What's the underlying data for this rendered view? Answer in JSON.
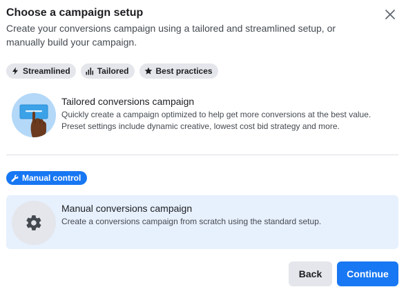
{
  "dialog": {
    "title": "Choose a campaign setup",
    "subtitle": "Create your conversions campaign using a tailored and streamlined setup, or manually build your campaign.",
    "close_icon": "close-icon"
  },
  "tags": [
    {
      "label": "Streamlined",
      "icon": "lightning-icon"
    },
    {
      "label": "Tailored",
      "icon": "bar-chart-icon"
    },
    {
      "label": "Best practices",
      "icon": "star-icon"
    }
  ],
  "tailored_option": {
    "title": "Tailored conversions campaign",
    "description": "Quickly create a campaign optimized to help get more conversions at the best value. Preset settings include dynamic creative, lowest cost bid strategy and more.",
    "icon": "hand-tapping-card-illustration"
  },
  "manual_badge": {
    "label": "Manual control",
    "icon": "wrench-icon"
  },
  "manual_option": {
    "title": "Manual conversions campaign",
    "description": "Create a conversions campaign from scratch using the standard setup.",
    "icon": "gear-icon",
    "selected": true
  },
  "footer": {
    "back_label": "Back",
    "continue_label": "Continue"
  },
  "colors": {
    "primary": "#1877f2",
    "selected_bg": "#e7f0fd",
    "tag_bg": "#e4e6eb"
  }
}
